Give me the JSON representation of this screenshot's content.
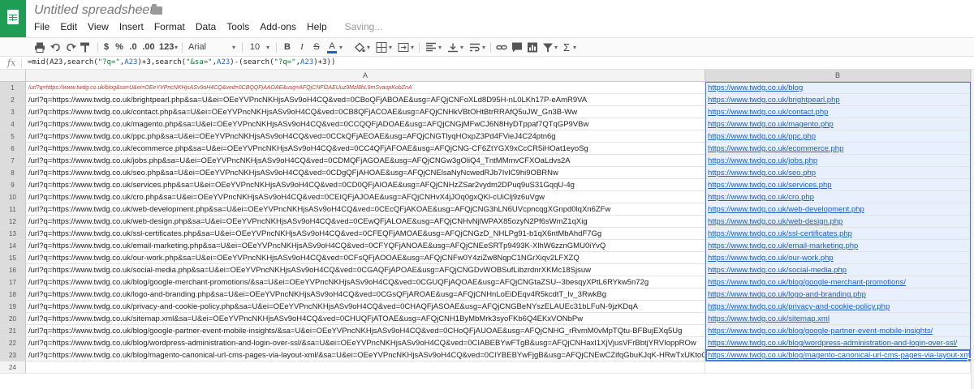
{
  "app": {
    "title": "Untitled spreadsheet",
    "status": "Saving...",
    "accent": "#1f9d55"
  },
  "menu": [
    "File",
    "Edit",
    "View",
    "Insert",
    "Format",
    "Data",
    "Tools",
    "Add-ons",
    "Help"
  ],
  "toolbar": {
    "currency": "$",
    "percent": "%",
    "decrease_decimal": ".0",
    "increase_decimal": ".00",
    "more_formats": "123",
    "font": "Arial",
    "font_size": "10",
    "bold": "B",
    "italic": "I",
    "strike": "S",
    "text_color": "A",
    "icons": [
      "print-icon",
      "undo-icon",
      "redo-icon",
      "paint-format-icon",
      "fill-color-icon",
      "borders-icon",
      "merge-cells-icon",
      "align-icon",
      "valign-icon",
      "link-icon",
      "comment-icon",
      "chart-icon",
      "filter-icon",
      "sum-icon"
    ]
  },
  "formula_bar": {
    "label": "fx",
    "p1": "=mid(A23,search(",
    "s1": "\"?q=\"",
    "p2": ",",
    "c1": "A23",
    "p3": ")+3,search(",
    "s2": "\"&sa=\"",
    "p4": ",",
    "c2": "A23",
    "p5": ")-(search(",
    "s3": "\"?q=\"",
    "p6": ",",
    "c3": "A23",
    "p7": ")+3))"
  },
  "columns": [
    "A",
    "B"
  ],
  "rows": [
    {
      "num": "1",
      "a": "/url?q=https://www.twdg.co.uk/blog&sa=U&ei=OEeYVPncNKHjsASv9oH4CQ&ved=0CBQQFjAAOAE&usg=AFQjCNFf2AEUuz9Mzl8hL9mSvaopKobZnA",
      "b": "https://www.twdg.co.uk/blog"
    },
    {
      "num": "2",
      "a": "/url?q=https://www.twdg.co.uk/brightpearl.php&sa=U&ei=OEeYVPncNKHjsASv9oH4CQ&ved=0CBoQFjABOAE&usg=AFQjCNFoXLd8D95H-nL0LKh17P-eAmR9VA",
      "b": "https://www.twdg.co.uk/brightpearl.php"
    },
    {
      "num": "3",
      "a": "/url?q=https://www.twdg.co.uk/contact.php&sa=U&ei=OEeYVPncNKHjsASv9oH4CQ&ved=0CB8QFjACOAE&usg=AFQjCNHkVBtOHtBtrRRAfQ5uJW_Gn3B-Ww",
      "b": "https://www.twdg.co.uk/contact.php"
    },
    {
      "num": "4",
      "a": "/url?q=https://www.twdg.co.uk/magento.php&sa=U&ei=OEeYVPncNKHjsASv9oH4CQ&ved=0CCQQFjADOAE&usg=AFQjCNGjMFwCJ6N8HyDTppaf7QTqGP9VBw",
      "b": "https://www.twdg.co.uk/magento.php"
    },
    {
      "num": "5",
      "a": "/url?q=https://www.twdg.co.uk/ppc.php&sa=U&ei=OEeYVPncNKHjsASv9oH4CQ&ved=0CCkQFjAEOAE&usg=AFQjCNGTlyqHOxpZ3Pd4FVieJ4C24ptn6g",
      "b": "https://www.twdg.co.uk/ppc.php"
    },
    {
      "num": "6",
      "a": "/url?q=https://www.twdg.co.uk/ecommerce.php&sa=U&ei=OEeYVPncNKHjsASv9oH4CQ&ved=0CC4QFjAFOAE&usg=AFQjCNG-CF6ZtYGX9xCcCR5iHOat1eyoSg",
      "b": "https://www.twdg.co.uk/ecommerce.php"
    },
    {
      "num": "7",
      "a": "/url?q=https://www.twdg.co.uk/jobs.php&sa=U&ei=OEeYVPncNKHjsASv9oH4CQ&ved=0CDMQFjAGOAE&usg=AFQjCNGw3gOliQ4_TntMMmvCFXOaLdvs2A",
      "b": "https://www.twdg.co.uk/jobs.php"
    },
    {
      "num": "8",
      "a": "/url?q=https://www.twdg.co.uk/seo.php&sa=U&ei=OEeYVPncNKHjsASv9oH4CQ&ved=0CDgQFjAHOAE&usg=AFQjCNElsaNyNcwedRJb7IvIC9hi9OBRNw",
      "b": "https://www.twdg.co.uk/seo.php"
    },
    {
      "num": "9",
      "a": "/url?q=https://www.twdg.co.uk/services.php&sa=U&ei=OEeYVPncNKHjsASv9oH4CQ&ved=0CD0QFjAIOAE&usg=AFQjCNHzZSar2vydm2DPuq9uS31GqqU-4g",
      "b": "https://www.twdg.co.uk/services.php"
    },
    {
      "num": "10",
      "a": "/url?q=https://www.twdg.co.uk/cro.php&sa=U&ei=OEeYVPncNKHjsASv9oH4CQ&ved=0CEIQFjAJOAE&usg=AFQjCNHvX4jJOq0gxQKl-cUiClj9z6uVgw",
      "b": "https://www.twdg.co.uk/cro.php"
    },
    {
      "num": "11",
      "a": "/url?q=https://www.twdg.co.uk/web-development.php&sa=U&ei=OEeYVPncNKHjsASv9oH4CQ&ved=0CEcQFjAKOAE&usg=AFQjCNG3hLN6UVcpncqgXGnpd0lqXn6ZFw",
      "b": "https://www.twdg.co.uk/web-development.php"
    },
    {
      "num": "12",
      "a": "/url?q=https://www.twdg.co.uk/web-design.php&sa=U&ei=OEeYVPncNKHjsASv9oH4CQ&ved=0CEwQFjALOAE&usg=AFQjCNHvNjlWPAX85ozyN2Pf6sWmZ1qXig",
      "b": "https://www.twdg.co.uk/web-design.php"
    },
    {
      "num": "13",
      "a": "/url?q=https://www.twdg.co.uk/ssl-certificates.php&sa=U&ei=OEeYVPncNKHjsASv9oH4CQ&ved=0CFEQFjAMOAE&usg=AFQjCNGzD_NHLPg91-b1qX6ntMbAhdF7Gg",
      "b": "https://www.twdg.co.uk/ssl-certificates.php"
    },
    {
      "num": "14",
      "a": "/url?q=https://www.twdg.co.uk/email-marketing.php&sa=U&ei=OEeYVPncNKHjsASv9oH4CQ&ved=0CFYQFjANOAE&usg=AFQjCNEeSRTp9493K-XlhW6zznGMU0iYvQ",
      "b": "https://www.twdg.co.uk/email-marketing.php"
    },
    {
      "num": "15",
      "a": "/url?q=https://www.twdg.co.uk/our-work.php&sa=U&ei=OEeYVPncNKHjsASv9oH4CQ&ved=0CFsQFjAOOAE&usg=AFQjCNFw0Y4ziZw8NqpC1NGrXiqv2LFXZQ",
      "b": "https://www.twdg.co.uk/our-work.php"
    },
    {
      "num": "16",
      "a": "/url?q=https://www.twdg.co.uk/social-media.php&sa=U&ei=OEeYVPncNKHjsASv9oH4CQ&ved=0CGAQFjAPOAE&usg=AFQjCNGDvWOBSufLibzrdnrXKMc18Sjsuw",
      "b": "https://www.twdg.co.uk/social-media.php"
    },
    {
      "num": "17",
      "a": "/url?q=https://www.twdg.co.uk/blog/google-merchant-promotions/&sa=U&ei=OEeYVPncNKHjsASv9oH4CQ&ved=0CGUQFjAQOAE&usg=AFQjCNGtaZSU--3besqyXPtL6RYkw5n72g",
      "b": "https://www.twdg.co.uk/blog/google-merchant-promotions/"
    },
    {
      "num": "18",
      "a": "/url?q=https://www.twdg.co.uk/logo-and-branding.php&sa=U&ei=OEeYVPncNKHjsASv9oH4CQ&ved=0CGsQFjAROAE&usg=AFQjCNHnLoEiDEqv4R5kcdtT_lv_3RwkBg",
      "b": "https://www.twdg.co.uk/logo-and-branding.php"
    },
    {
      "num": "19",
      "a": "/url?q=https://www.twdg.co.uk/privacy-and-cookie-policy.php&sa=U&ei=OEeYVPncNKHjsASv9oH4CQ&ved=0CHAQFjASOAE&usg=AFQjCNGBeNYszELAUEc31bLFuN-9jzKDqA",
      "b": "https://www.twdg.co.uk/privacy-and-cookie-policy.php"
    },
    {
      "num": "20",
      "a": "/url?q=https://www.twdg.co.uk/sitemap.xml&sa=U&ei=OEeYVPncNKHjsASv9oH4CQ&ved=0CHUQFjATOAE&usg=AFQjCNH1ByMbMrk3syoFKb6Q4EKxVONbPw",
      "b": "https://www.twdg.co.uk/sitemap.xml"
    },
    {
      "num": "21",
      "a": "/url?q=https://www.twdg.co.uk/blog/google-partner-event-mobile-insights/&sa=U&ei=OEeYVPncNKHjsASv9oH4CQ&ved=0CHoQFjAUOAE&usg=AFQjCNHG_rRvmM0vMpTQtu-BFBujEXq5Ug",
      "b": "https://www.twdg.co.uk/blog/google-partner-event-mobile-insights/"
    },
    {
      "num": "22",
      "a": "/url?q=https://www.twdg.co.uk/blog/wordpress-administration-and-login-over-ssl/&sa=U&ei=OEeYVPncNKHjsASv9oH4CQ&ved=0CIABEBYwFTgB&usg=AFQjCNHaxI1XjVjusVFrBbtjYRVIoppROw",
      "b": "https://www.twdg.co.uk/blog/wordpress-administration-and-login-over-ssl/"
    },
    {
      "num": "23",
      "a": "/url?q=https://www.twdg.co.uk/blog/magento-canonical-url-cms-pages-via-layout-xml/&sa=U&ei=OEeYVPncNKHjsASv9oH4CQ&ved=0CIYBEBYwFjgB&usg=AFQjCNEwCZifqGbuKJqK-HRwTxUKtoQRdw",
      "b": "https://www.twdg.co.uk/blog/magento-canonical-url-cms-pages-via-layout-xml/"
    },
    {
      "num": "24",
      "a": "",
      "b": ""
    }
  ]
}
